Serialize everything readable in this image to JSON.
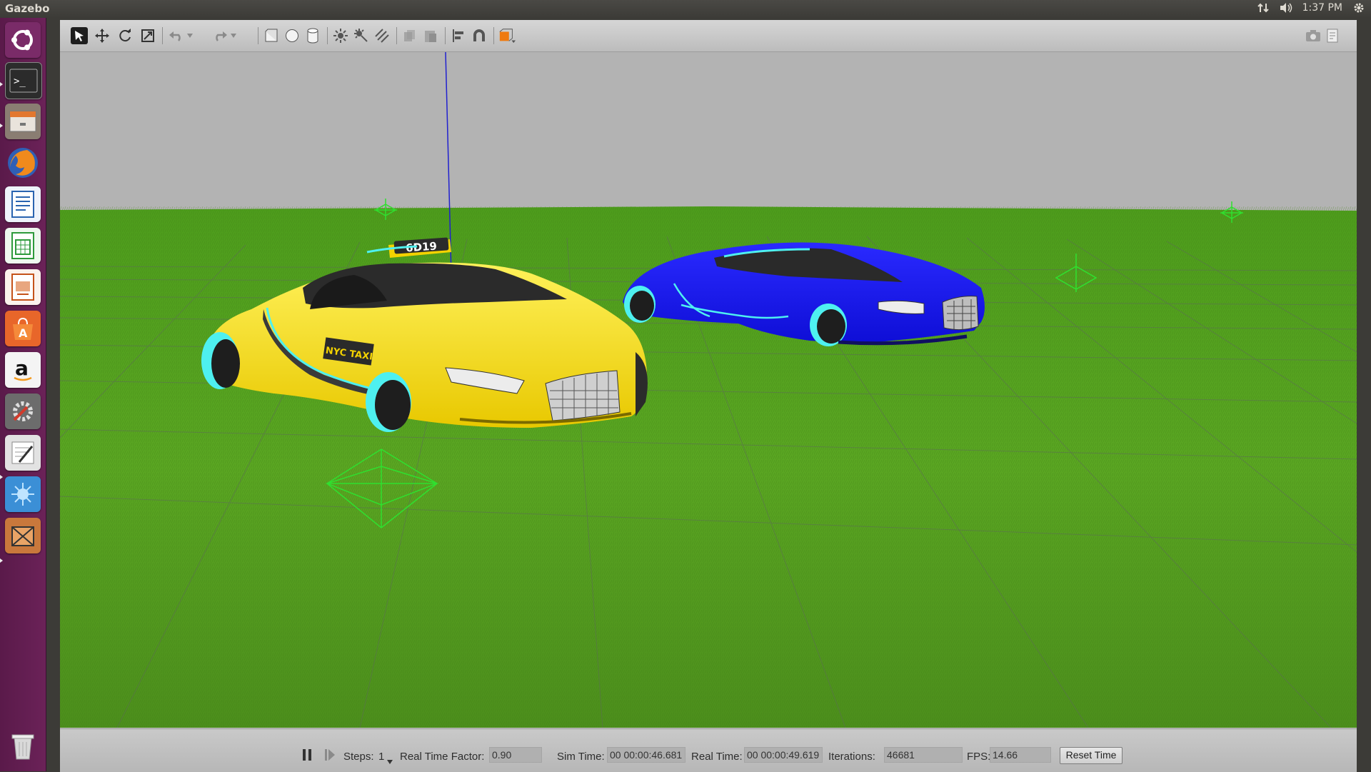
{
  "top_panel": {
    "app_title": "Gazebo",
    "clock": "1:37 PM",
    "icons": [
      "network-icon",
      "volume-icon",
      "gear-icon"
    ]
  },
  "launcher": {
    "items": [
      "ubuntu-dash-icon",
      "terminal-icon",
      "files-icon",
      "firefox-icon",
      "writer-icon",
      "calc-icon",
      "impress-icon",
      "software-center-icon",
      "amazon-icon",
      "system-settings-icon",
      "text-editor-icon",
      "gazebo-icon",
      "package-icon"
    ],
    "trash": "trash-icon"
  },
  "toolbar": {
    "tools": [
      "select-icon",
      "translate-icon",
      "rotate-icon",
      "scale-icon",
      "undo-icon",
      "redo-icon",
      "box-icon",
      "sphere-icon",
      "cylinder-icon",
      "point-light-icon",
      "spot-light-icon",
      "directional-light-icon",
      "copy-icon",
      "paste-icon",
      "align-icon",
      "snap-icon",
      "view-angle-icon",
      "screenshot-icon",
      "log-icon"
    ]
  },
  "scene": {
    "taxi_sign": "6D19",
    "taxi_logo": "NYC TAXI",
    "taxi_color": "#fff020",
    "blue_car_color": "#1a1aef",
    "ground_color": "#4f9a1f",
    "sky_color": "#b3b3b3"
  },
  "bottom_bar": {
    "steps_label": "Steps:",
    "steps_value": "1",
    "rtf_label": "Real Time Factor:",
    "rtf_value": "0.90",
    "sim_time_label": "Sim Time:",
    "sim_time_value": "00 00:00:46.681",
    "real_time_label": "Real Time:",
    "real_time_value": "00 00:00:49.619",
    "iterations_label": "Iterations:",
    "iterations_value": "46681",
    "fps_label": "FPS:",
    "fps_value": "14.66",
    "reset_label": "Reset Time"
  }
}
